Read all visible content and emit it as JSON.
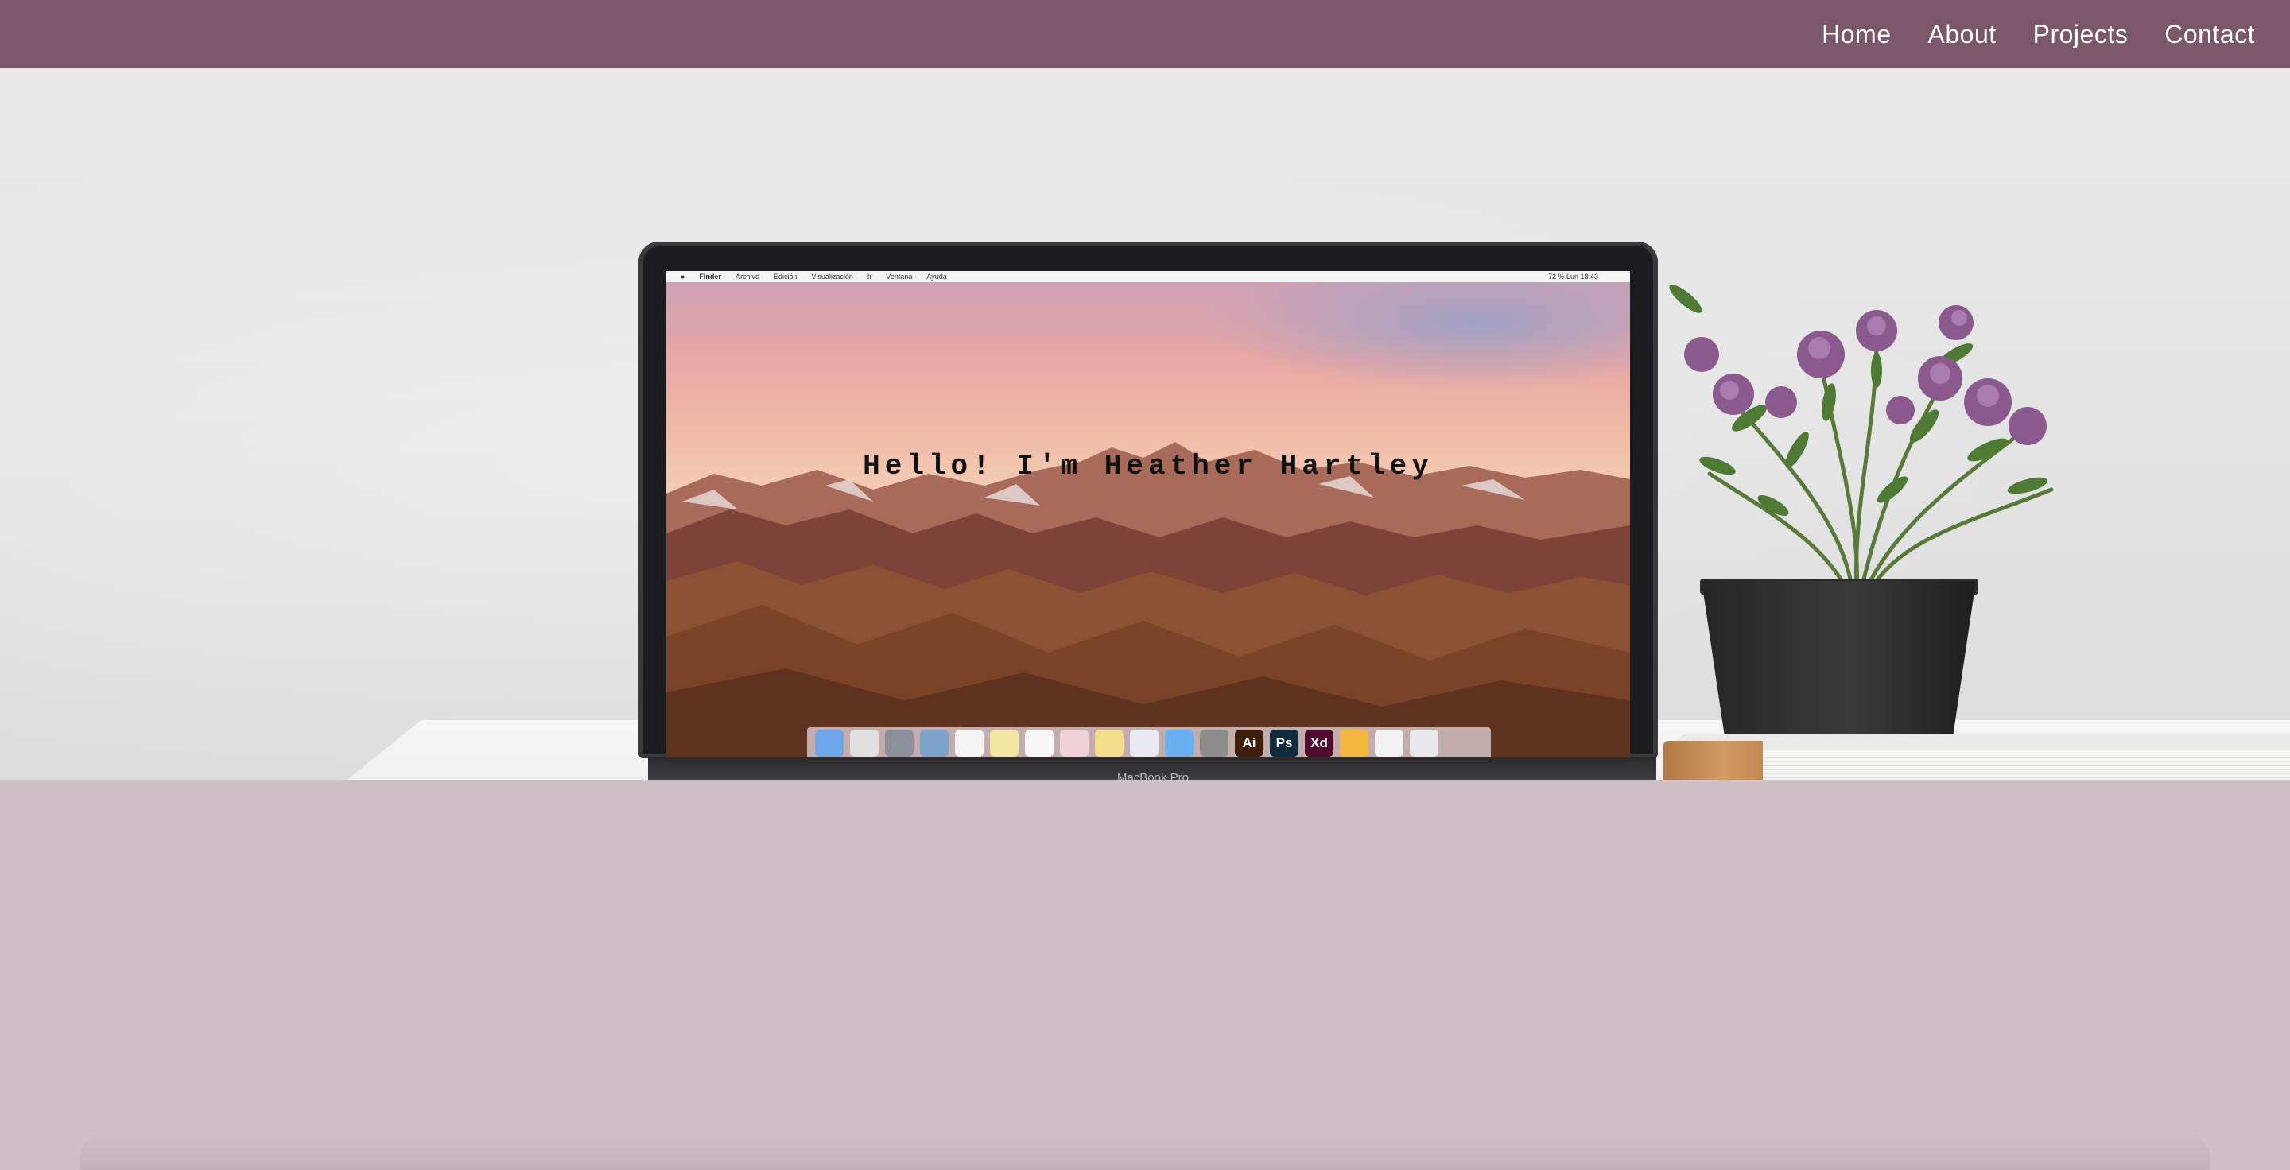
{
  "nav": {
    "items": [
      {
        "label": "Home"
      },
      {
        "label": "About"
      },
      {
        "label": "Projects"
      },
      {
        "label": "Contact"
      }
    ],
    "background": "#7a5769"
  },
  "hero": {
    "title": "Hello! I'm Heather Hartley",
    "laptop_label": "MacBook Pro",
    "screen_menubar": {
      "app": "Finder",
      "menus": [
        "Archivo",
        "Edición",
        "Visualización",
        "Ir",
        "Ventana",
        "Ayuda"
      ],
      "status": "72 %   Lun 18:43"
    },
    "dock_icons": [
      {
        "name": "finder-icon",
        "glyph": "",
        "color": "#6fa6e8"
      },
      {
        "name": "chrome-icon",
        "glyph": "",
        "color": "#e0e0e0"
      },
      {
        "name": "launchpad-icon",
        "glyph": "",
        "color": "#8a8f99"
      },
      {
        "name": "preview-icon",
        "glyph": "",
        "color": "#7ca2c9"
      },
      {
        "name": "calendar-icon",
        "glyph": "",
        "color": "#f4f4f4"
      },
      {
        "name": "notes-icon",
        "glyph": "",
        "color": "#f3e6a3"
      },
      {
        "name": "textedit-icon",
        "glyph": "",
        "color": "#f7f7f7"
      },
      {
        "name": "photos-icon",
        "glyph": "",
        "color": "#f0d0d8"
      },
      {
        "name": "stickies-icon",
        "glyph": "",
        "color": "#f2dd8a"
      },
      {
        "name": "itunes-icon",
        "glyph": "",
        "color": "#e9e9f2"
      },
      {
        "name": "appstore-icon",
        "glyph": "",
        "color": "#6ab0f0"
      },
      {
        "name": "system-preferences-icon",
        "glyph": "",
        "color": "#8d8d8d"
      },
      {
        "name": "illustrator-icon",
        "glyph": "Ai",
        "color": "#3e1f0c"
      },
      {
        "name": "photoshop-icon",
        "glyph": "Ps",
        "color": "#0e2b40"
      },
      {
        "name": "xd-icon",
        "glyph": "Xd",
        "color": "#4f0b30"
      },
      {
        "name": "sketch-icon",
        "glyph": "",
        "color": "#f4b73c"
      },
      {
        "name": "downloads-icon",
        "glyph": "",
        "color": "#f2f2f2"
      },
      {
        "name": "trash-icon",
        "glyph": "",
        "color": "#e8e8ea"
      }
    ]
  },
  "lower": {
    "background": "#cfc0c7"
  }
}
